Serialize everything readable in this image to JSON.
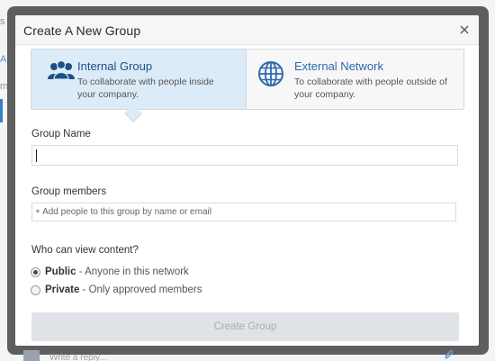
{
  "background": {
    "fragments": [
      "s ar",
      "All",
      "mp",
      "N",
      "Ju",
      "@",
      "s",
      "L"
    ],
    "reply_placeholder": "Write a reply..."
  },
  "modal": {
    "title": "Create A New Group",
    "close_icon": "close-icon"
  },
  "group_types": [
    {
      "name": "Internal Group",
      "description": "To collaborate with people inside your company.",
      "icon": "people-icon",
      "selected": true
    },
    {
      "name": "External Network",
      "description": "To collaborate with people outside of your company.",
      "icon": "globe-icon",
      "selected": false
    }
  ],
  "form": {
    "group_name_label": "Group Name",
    "group_name_value": "",
    "members_label": "Group members",
    "members_placeholder": "+ Add people to this group by name or email",
    "view_label": "Who can view content?",
    "visibility_options": [
      {
        "name": "Public",
        "description": " - Anyone in this network",
        "checked": true
      },
      {
        "name": "Private",
        "description": " - Only approved members",
        "checked": false
      }
    ],
    "submit_label": "Create Group"
  },
  "colors": {
    "accent_text": "#1d4f86",
    "selected_card": "#dcebf8",
    "disabled_button": "#dfe3e8",
    "overlay": "#5e5e5e"
  }
}
